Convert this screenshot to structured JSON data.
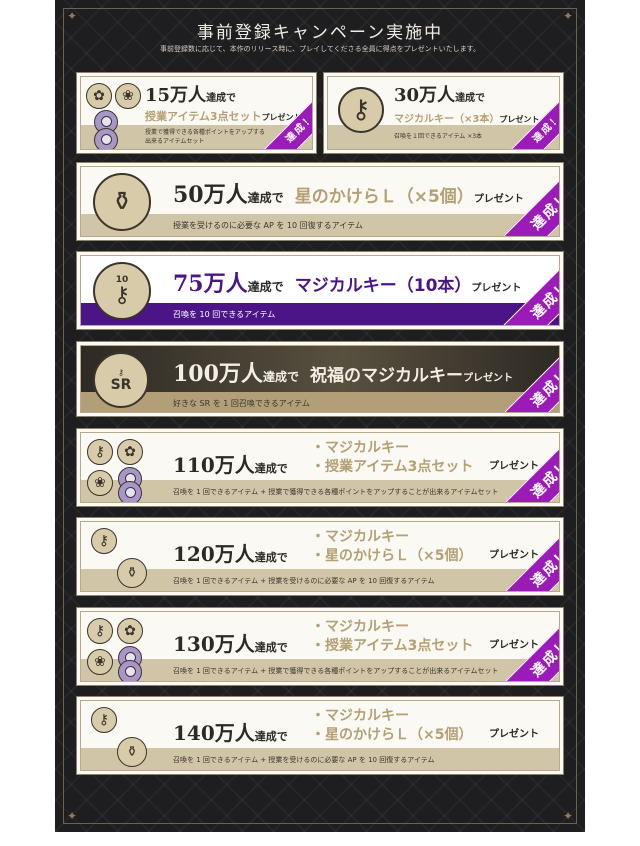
{
  "header": {
    "title": "事前登録キャンペーン実施中",
    "subtitle": "事前登録数に応じて、本作のリリース時に、プレイしてくださる全員に得点をプレゼントいたします。"
  },
  "badge_label": "達成！",
  "rewards": [
    {
      "count": "15万人",
      "achieved": "達成で",
      "item": "授業アイテム3点セット",
      "present": "プレゼント",
      "desc_line1": "授業で獲得できる各種ポイントをアップする",
      "desc_line2": "出来るアイテムセット",
      "icons": [
        "flower-pot-icon",
        "flower-pot-icon",
        "candy-icon",
        "candy-icon"
      ]
    },
    {
      "count": "30万人",
      "achieved": "達成で",
      "item": "マジカルキー（×3本）",
      "present": "プレゼント",
      "desc": "召喚を１回できるアイテム ×3本",
      "icons": [
        "key-icon"
      ]
    },
    {
      "count": "50万人",
      "achieved": "達成で",
      "item": "星のかけらＬ（×5個）",
      "present": "プレゼント",
      "desc": "授業を受けるのに必要な AP を 10 回復するアイテム",
      "icons": [
        "star-bottle-icon"
      ]
    },
    {
      "count": "75万人",
      "achieved": "達成で",
      "item": "マジカルキー（10本）",
      "present": "プレゼント",
      "desc": "召喚を 10 回できるアイテム",
      "medal_text": "10",
      "icons": [
        "key-bundle-icon"
      ]
    },
    {
      "count": "100万人",
      "achieved": "達成で",
      "item": "祝福のマジカルキー",
      "present": "プレゼント",
      "desc": "好きな SR を 1 回召喚できるアイテム",
      "medal_text": "SR",
      "icons": [
        "sr-key-icon"
      ]
    },
    {
      "count": "110万人",
      "achieved": "達成で",
      "item_lines": [
        "・マジカルキー",
        "・授業アイテム3点セット"
      ],
      "present": "プレゼント",
      "desc": "召喚を 1 回できるアイテム + 授業で獲得できる各種ポイントをアップすることが出来るアイテムセット",
      "icons": [
        "key-icon",
        "flower-pot-icon",
        "flower-pot-icon",
        "candy-icon",
        "candy-icon"
      ]
    },
    {
      "count": "120万人",
      "achieved": "達成で",
      "item_lines": [
        "・マジカルキー",
        "・星のかけらＬ（×5個）"
      ],
      "present": "プレゼント",
      "desc": "召喚を 1 回できるアイテム + 授業を受けるのに必要な AP を 10 回復するアイテム",
      "icons": [
        "key-icon",
        "star-bottle-icon"
      ]
    },
    {
      "count": "130万人",
      "achieved": "達成で",
      "item_lines": [
        "・マジカルキー",
        "・授業アイテム3点セット"
      ],
      "present": "プレゼント",
      "desc": "召喚を 1 回できるアイテム + 授業で獲得できる各種ポイントをアップすることが出来るアイテムセット",
      "icons": [
        "key-icon",
        "flower-pot-icon",
        "flower-pot-icon",
        "candy-icon",
        "candy-icon"
      ]
    },
    {
      "count": "140万人",
      "achieved": "達成で",
      "item_lines": [
        "・マジカルキー",
        "・星のかけらＬ（×5個）"
      ],
      "present": "プレゼント",
      "desc": "召喚を 1 回できるアイテム + 授業を受けるのに必要な AP を 10 回復するアイテム",
      "icons": [
        "key-icon",
        "star-bottle-icon"
      ]
    }
  ],
  "colors": {
    "background": "#1e1d20",
    "card": "#fbf9f4",
    "band": "#d1c5a7",
    "accent_gold": "#b59f74",
    "badge_purple": "#9a1bb8",
    "premium_purple": "#4b1588"
  }
}
